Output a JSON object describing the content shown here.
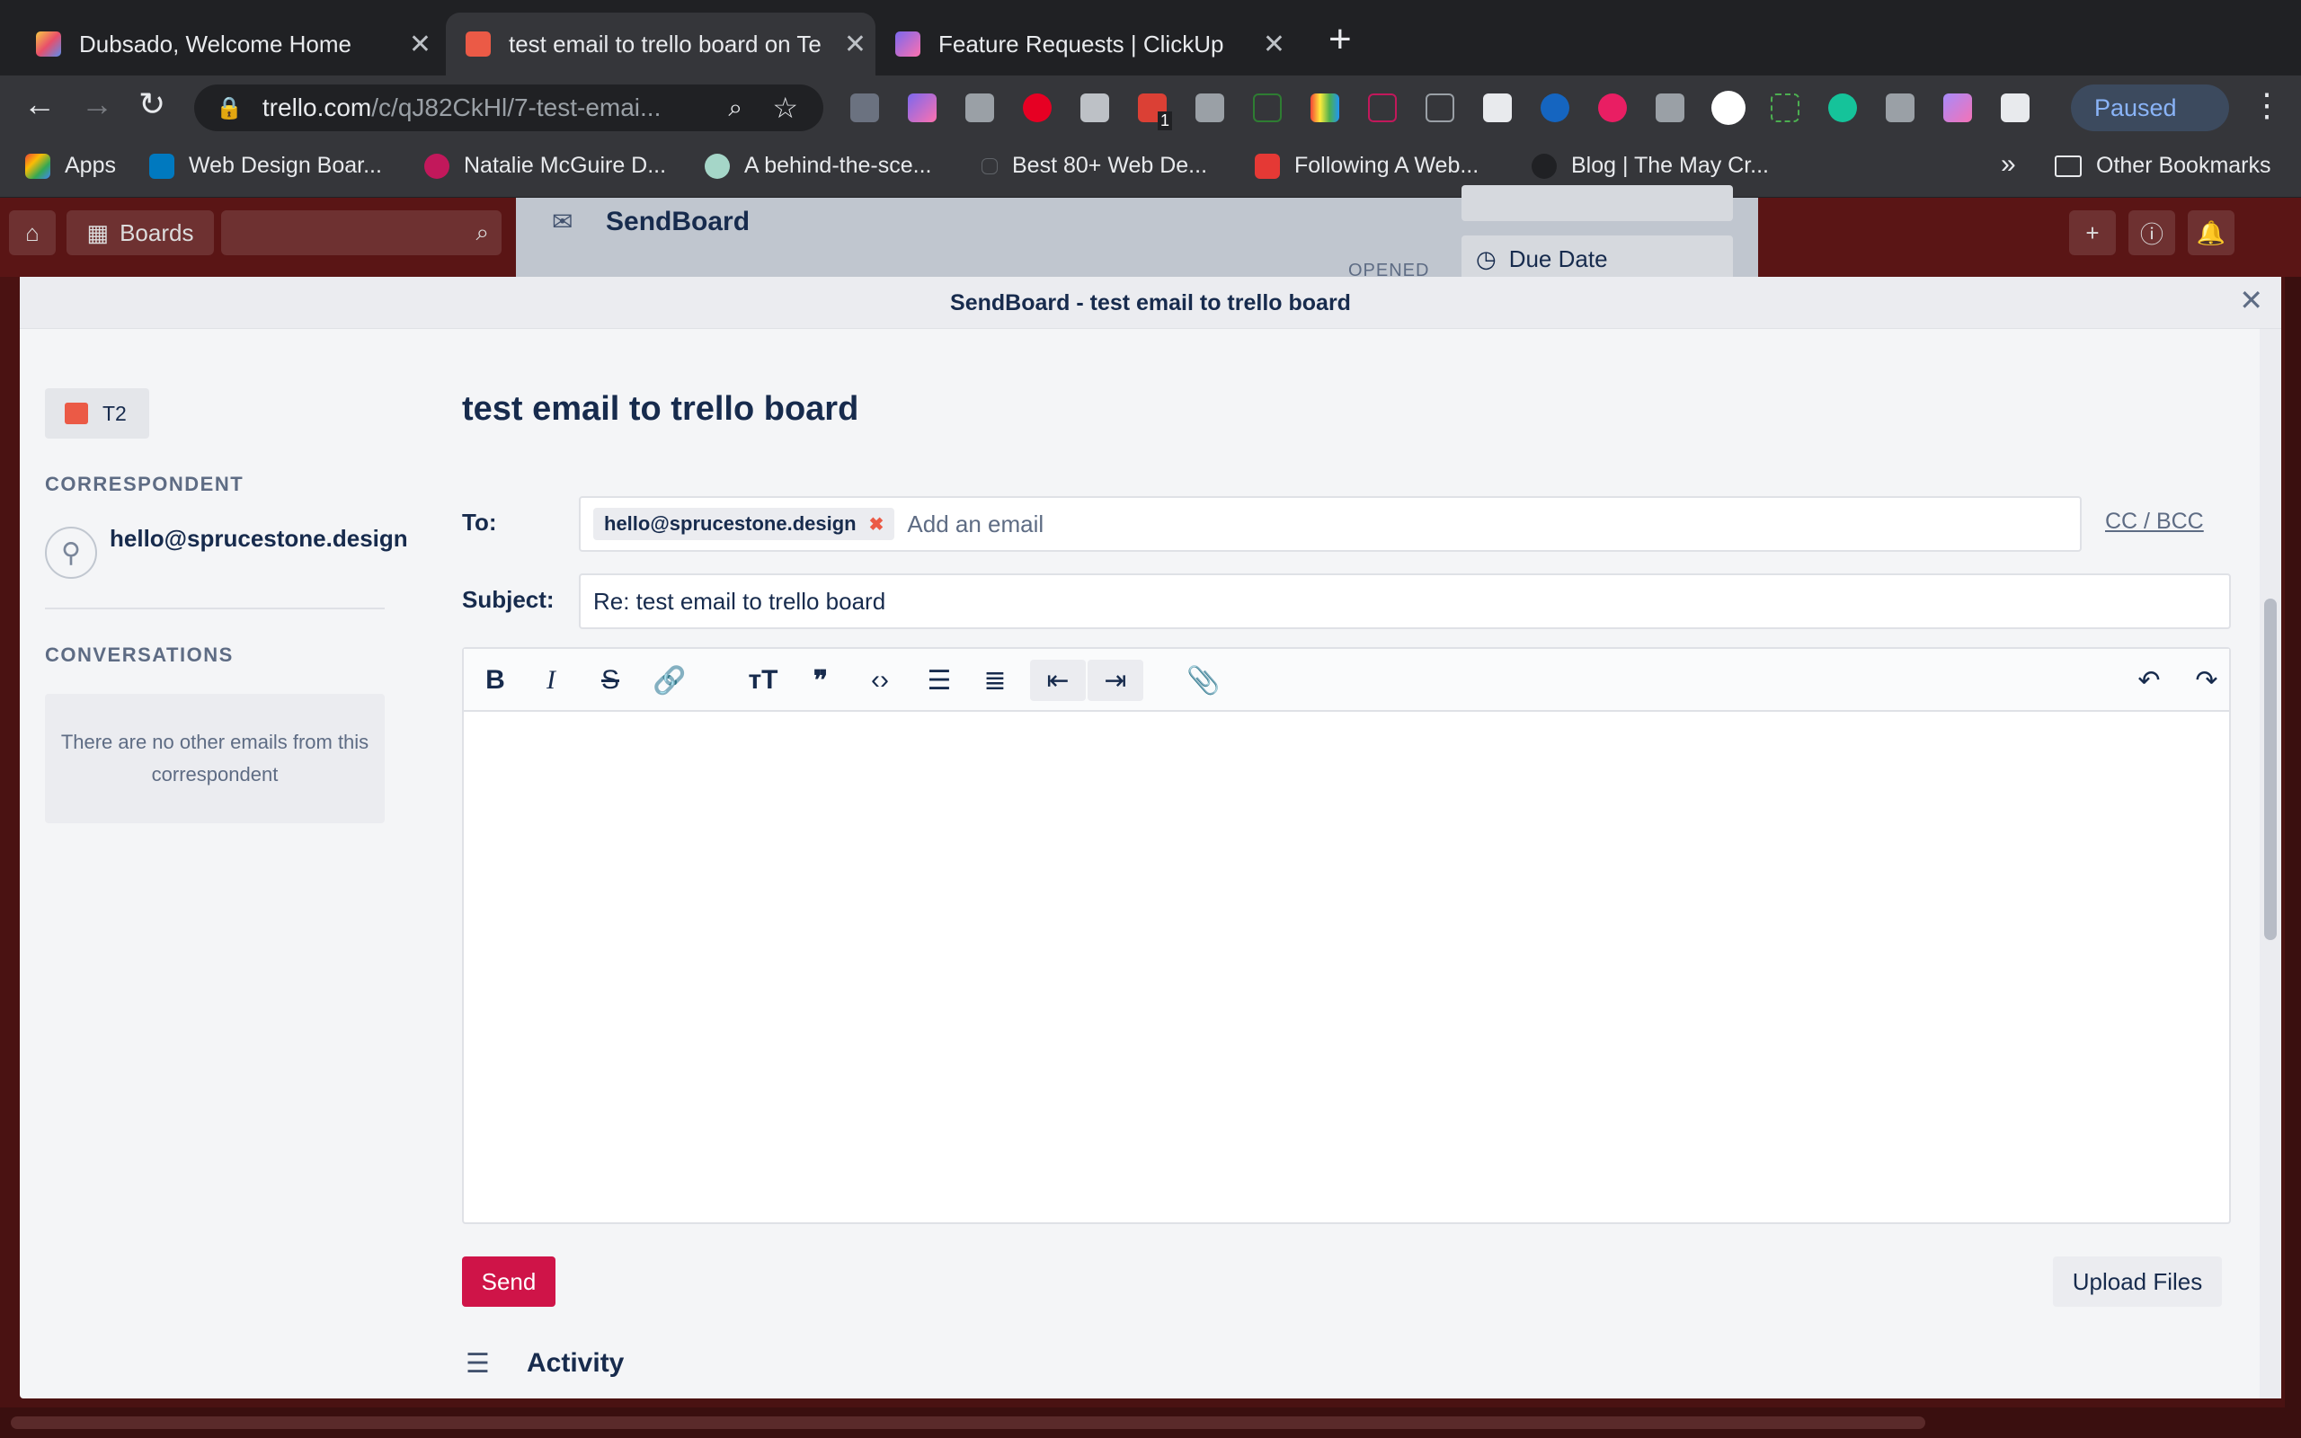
{
  "browser": {
    "tabs": [
      {
        "title": "Dubsado, Welcome Home",
        "active": false,
        "icon": "dubsado-icon"
      },
      {
        "title": "test email to trello board on Te",
        "active": true,
        "icon": "trello-icon"
      },
      {
        "title": "Feature Requests | ClickUp",
        "active": false,
        "icon": "clickup-icon"
      }
    ],
    "url_host": "trello.com",
    "url_path": "/c/qJ82CkHl/7-test-emai...",
    "profile_status": "Paused",
    "bookmarks": [
      "Apps",
      "Web Design Boar...",
      "Natalie McGuire D...",
      "A behind-the-sce...",
      "Best 80+ Web De...",
      "Following A Web...",
      "Blog | The May Cr..."
    ],
    "overflow": "»",
    "other_bookmarks": "Other Bookmarks",
    "extension_badge": "1"
  },
  "trello": {
    "boards_label": "Boards",
    "behind_title": "SendBoard",
    "behind_status": "OPENED",
    "behind_due": "Due Date"
  },
  "modal": {
    "header": "SendBoard - test email to trello board",
    "badge": "T2",
    "correspondent_heading": "CORRESPONDENT",
    "correspondent_email": "hello@sprucestone.design",
    "conversations_heading": "CONVERSATIONS",
    "no_conversations": "There are no other emails from this correspondent",
    "title": "test email to trello board",
    "to_label": "To:",
    "to_chip": "hello@sprucestone.design",
    "to_placeholder": "Add an email",
    "cc_bcc": "CC / BCC",
    "subject_label": "Subject:",
    "subject_value": "Re: test email to trello board",
    "send": "Send",
    "upload": "Upload Files",
    "activity": "Activity"
  },
  "colors": {
    "accent": "#cf1448",
    "trello_red": "#eb5a46",
    "backdrop": "#4a1212"
  }
}
